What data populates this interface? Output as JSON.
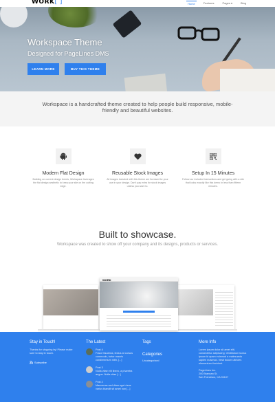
{
  "header": {
    "logo_text": "WORK",
    "logo_bracket": "[ ]",
    "nav": [
      "Home",
      "Features",
      "Pages ▾",
      "Blog"
    ],
    "active_nav": "Home"
  },
  "hero": {
    "title": "Workspace Theme",
    "subtitle": "Designed for PageLines DMS",
    "learn_more": "LEARN MORE",
    "buy": "BUY THIS THEME"
  },
  "intro": {
    "text": "Workspace is a handcrafted theme created to help people build responsive, mobile-friendly and beautiful websites."
  },
  "features": [
    {
      "icon": "android-icon",
      "title": "Modern Flat Design",
      "desc": "Building on current design trends, Workspace leverages the flat design aesthetic to keep your site on the cutting edge."
    },
    {
      "icon": "heart-icon",
      "title": "Reusable Stock Images",
      "desc": "All images included with this theme are licensed for your use in your design. Don't pay extra for stock images unless you want to."
    },
    {
      "icon": "qrcode-icon",
      "title": "Setup In 15 Minutes",
      "desc": "Follow our included instructions and get going with a site that looks exactly like this demo in less than fifteen minutes."
    }
  ],
  "showcase": {
    "title": "Built to showcase.",
    "subtitle": "Workspace was created to show off your company and its designs, products or services."
  },
  "footer": {
    "stay": {
      "title": "Stay in Touch!",
      "text": "Thanks for stopping by! Please make sure to stay in touch.",
      "subscribe": "Subscribe"
    },
    "latest": {
      "title": "The Latest",
      "posts": [
        {
          "title": "Post 4",
          "text": "Fusce faucibus, lectus at cursus commodo, tortor mauris condimentum nibh, [...]"
        },
        {
          "title": "Post 3",
          "text": "Nulla vitae elit libero, a pharetra augue. Nulla vitae [...]"
        },
        {
          "title": "Post 2",
          "text": "Maecenas sed diam eget risus varius blandit sit amet non [...]"
        }
      ]
    },
    "tags": {
      "title": "Tags",
      "categories_title": "Categories",
      "categories": [
        "Uncategorized"
      ]
    },
    "more": {
      "title": "More Info",
      "text": "Lorem ipsum dolor sit amet elit, consectetur adipiscing. Vestibulum luctus ipsum id quam euismod a malesuada sapien euismod. Vesti bulum ultricies elementum tincidunt.",
      "address": [
        "PageLines Inc.",
        "200 Brannan St.",
        "San Francisco, CA 94107"
      ]
    }
  }
}
